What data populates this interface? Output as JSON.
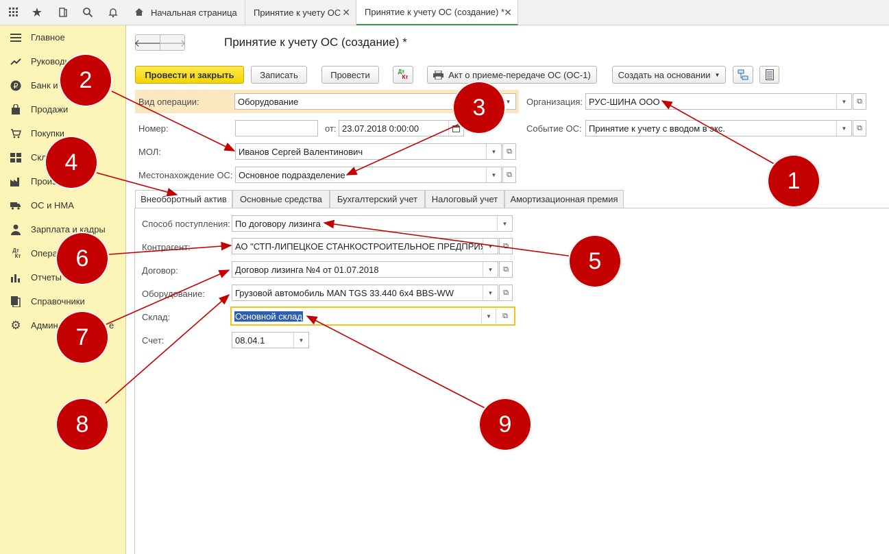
{
  "tabs": [
    {
      "label": "Начальная страница"
    },
    {
      "label": "Принятие к учету ОС"
    },
    {
      "label": "Принятие к учету ОС (создание) *"
    }
  ],
  "sidebar": {
    "items": [
      {
        "label": "Главное",
        "icon": "menu-icon"
      },
      {
        "label": "Руководи",
        "icon": "trend-icon"
      },
      {
        "label": "Банк и",
        "icon": "ruble-icon"
      },
      {
        "label": "Продажи",
        "icon": "bag-icon"
      },
      {
        "label": "Покупки",
        "icon": "cart-icon"
      },
      {
        "label": "Скл",
        "icon": "grid-icon"
      },
      {
        "label": "Произв",
        "icon": "factory-icon"
      },
      {
        "label": "ОС и НМА",
        "icon": "truck-icon"
      },
      {
        "label": "Зарплата и кадры",
        "icon": "person-icon"
      },
      {
        "label": "Опера",
        "icon": "dtkt-icon"
      },
      {
        "label": "Отчеты",
        "icon": "bar-chart-icon"
      },
      {
        "label": "Справочники",
        "icon": "books-icon"
      },
      {
        "label": "Админ",
        "icon": "gear-icon",
        "suffix": "е"
      }
    ]
  },
  "header": {
    "title": "Принятие к учету ОС (создание) *"
  },
  "toolbar": {
    "post_close": "Провести и закрыть",
    "save": "Записать",
    "post": "Провести",
    "dtkt": "ДтКт",
    "act": "Акт о приеме-передаче ОС (ОС-1)",
    "create_based": "Создать на основании"
  },
  "form": {
    "operation_label": "Вид операции:",
    "operation_value": "Оборудование",
    "org_label": "Организация:",
    "org_value": "РУС-ШИНА ООО",
    "number_label": "Номер:",
    "number_value": "",
    "date_label": "от:",
    "date_value": "23.07.2018  0:00:00",
    "event_label": "Событие ОС:",
    "event_value": "Принятие к учету с вводом в экс.",
    "mol_label": "МОЛ:",
    "mol_value": "Иванов Сергей Валентинович",
    "location_label": "Местонахождение ОС:",
    "location_value": "Основное подразделение"
  },
  "form_tabs": [
    {
      "label": "Внеоборотный актив"
    },
    {
      "label": "Основные средства"
    },
    {
      "label": "Бухгалтерский учет"
    },
    {
      "label": "Налоговый учет"
    },
    {
      "label": "Амортизационная премия"
    }
  ],
  "asset": {
    "receipt_label": "Способ поступления:",
    "receipt_value": "По договору лизинга",
    "counterparty_label": "Контрагент:",
    "counterparty_value": "АО \"СТП-ЛИПЕЦКОЕ СТАНКОСТРОИТЕЛЬНОЕ ПРЕДПРИЯ",
    "contract_label": "Договор:",
    "contract_value": "Договор лизинга №4 от 01.07.2018",
    "equipment_label": "Оборудование:",
    "equipment_value": "Грузовой автомобиль MAN TGS 33.440 6х4 BBS-WW",
    "warehouse_label": "Склад:",
    "warehouse_value": "Основной склад",
    "account_label": "Счет:",
    "account_value": "08.04.1"
  },
  "badges": [
    "1",
    "2",
    "3",
    "4",
    "5",
    "6",
    "7",
    "8",
    "9"
  ],
  "colors": {
    "accent": "#f5d400",
    "sidebar": "#fdf5b7",
    "badge": "#c40000",
    "active_tab_line": "#3a9a3a"
  }
}
